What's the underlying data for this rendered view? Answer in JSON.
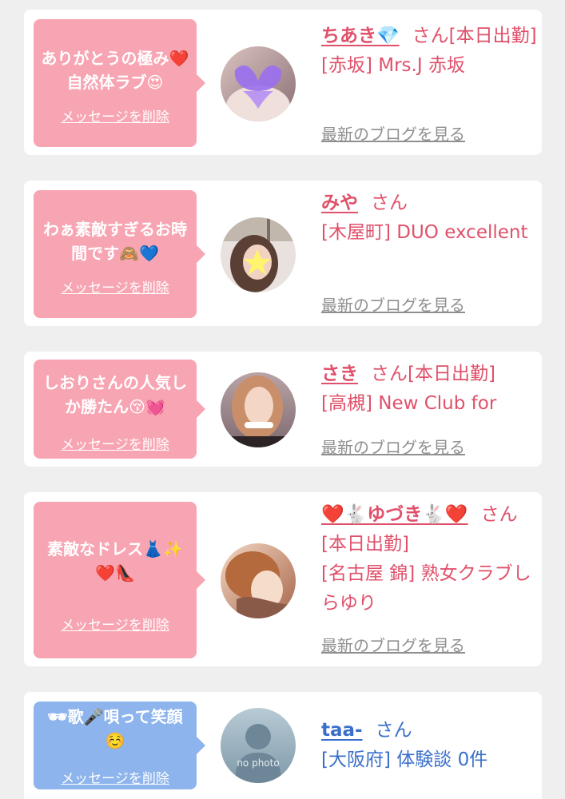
{
  "messages": [
    {
      "text": "ありがとうの極み❤️自然体ラブ😍",
      "delete_label": "メッセージを削除",
      "name": "ちあき💎",
      "honorific": "さん[本日出勤]",
      "location": "[赤坂] Mrs.J 赤坂",
      "blog_label": "最新のブログを見る"
    },
    {
      "text": "わぁ素敵すぎるお時間です🙈💙",
      "delete_label": "メッセージを削除",
      "name": "みや",
      "honorific": "さん",
      "location": "[木屋町] DUO excellent",
      "blog_label": "最新のブログを見る"
    },
    {
      "text": "しおりさんの人気しか勝たん😚💓",
      "delete_label": "メッセージを削除",
      "name": "さき",
      "honorific": "さん[本日出勤]",
      "location": "[高槻] New Club for",
      "blog_label": "最新のブログを見る"
    },
    {
      "text": "素敵なドレス👗✨❤️👠",
      "delete_label": "メッセージを削除",
      "name": "❤️🐇ゆづき🐇❤️",
      "honorific": "さん[本日出勤]",
      "location": "[名古屋 錦] 熟女クラブしらゆり",
      "blog_label": "最新のブログを見る"
    },
    {
      "text": "🕶歌🎤唄って笑顔☺️",
      "delete_label": "メッセージを削除",
      "name": "taa-",
      "honorific": "さん",
      "location": "[大阪府] 体験談 0件",
      "avatar_text": "no photo"
    }
  ],
  "colors": {
    "pink_bubble": "#f8a5b3",
    "blue_bubble": "#8db4ec",
    "pink_text": "#e0506a",
    "blue_text": "#3a6fc9",
    "link_gray": "#8f8f8f"
  }
}
